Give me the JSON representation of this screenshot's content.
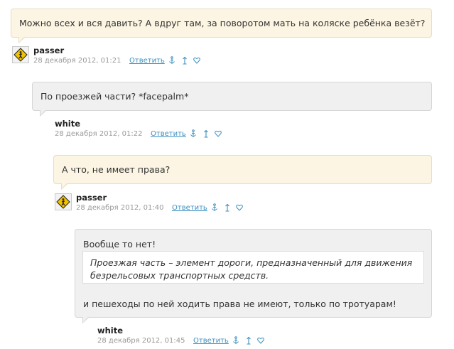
{
  "comments": [
    {
      "text": "Можно всех и вся давить? А вдруг там, за поворотом мать на коляске ребёнка везёт?",
      "username": "passer",
      "date": "28 декабря 2012, 01:21",
      "reply_label": "Ответить",
      "has_avatar": true
    },
    {
      "text": "По проезжей части? *facepalm*",
      "username": "white",
      "date": "28 декабря 2012, 01:22",
      "reply_label": "Ответить",
      "has_avatar": false
    },
    {
      "text": "А что, не имеет права?",
      "username": "passer",
      "date": "28 декабря 2012, 01:40",
      "reply_label": "Ответить",
      "has_avatar": true
    },
    {
      "text": "Вообще то нет!",
      "quote": "Проезжая часть – элемент дороги, предназначенный для движения безрельсовых транспортных средств.",
      "text_after": "и пешеходы по ней ходить права не имеют, только по тротуарам!",
      "username": "white",
      "date": "28 декабря 2012, 01:45",
      "reply_label": "Ответить",
      "has_avatar": false
    }
  ],
  "icons": {
    "anchor": "anchor-icon",
    "parent": "up-arrow-icon",
    "favorite": "heart-icon"
  },
  "colors": {
    "bubble_user1": "#fcf5e3",
    "bubble_user2": "#f0f0f0",
    "link": "#3b8fc0",
    "date": "#999999"
  }
}
